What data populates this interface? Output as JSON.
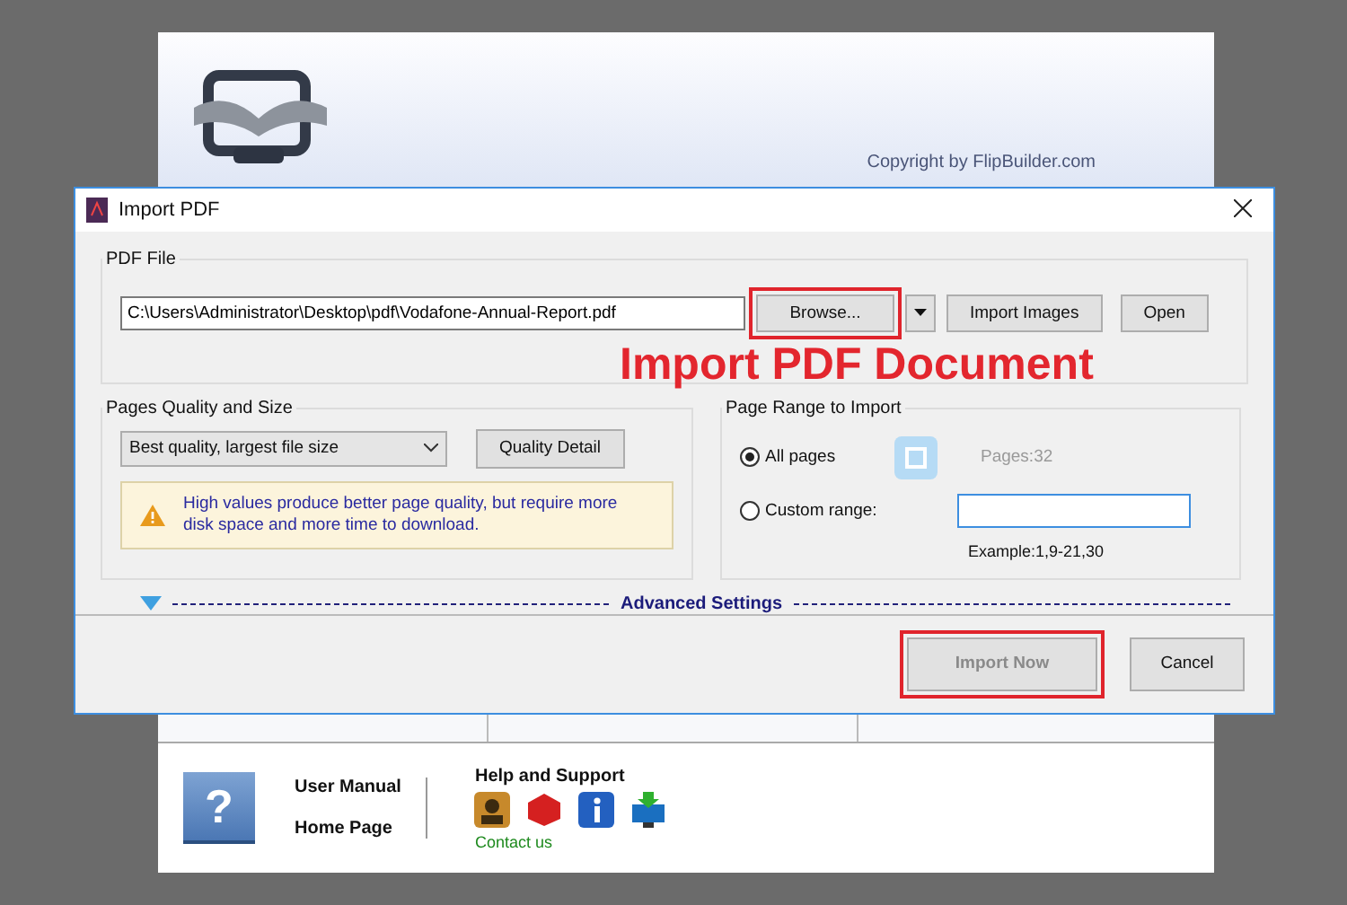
{
  "app": {
    "help_icon": "?",
    "copyright": "Copyright by FlipBuilder.com",
    "footer": {
      "links": [
        "User Manual",
        "Home Page"
      ],
      "help_title": "Help and Support",
      "contact": "Contact us"
    }
  },
  "dialog": {
    "title": "Import PDF",
    "pdf_file": {
      "label": "PDF File",
      "path": "C:\\Users\\Administrator\\Desktop\\pdf\\Vodafone-Annual-Report.pdf",
      "buttons": [
        {
          "label": "Browse...",
          "highlighted": true
        },
        {
          "label": "Import Images",
          "highlighted": false
        },
        {
          "label": "Open",
          "highlighted": false
        }
      ]
    },
    "quality": {
      "label": "Pages Quality and Size",
      "value": "Best quality, largest file size",
      "detail_button": "Quality Detail",
      "warning": "High values produce better page quality, but require more disk space and more time to download."
    },
    "range": {
      "label": "Page Range to Import",
      "options": [
        {
          "label": "All pages",
          "selected": true
        },
        {
          "label": "Custom range:",
          "selected": false
        }
      ],
      "pages": "Pages:32",
      "example": "Example:1,9-21,30"
    },
    "advanced": "Advanced Settings",
    "actions": [
      {
        "label": "Import Now",
        "highlighted": true,
        "disabled": true
      },
      {
        "label": "Cancel",
        "highlighted": false,
        "disabled": false
      }
    ]
  },
  "annotation": "Import PDF Document"
}
